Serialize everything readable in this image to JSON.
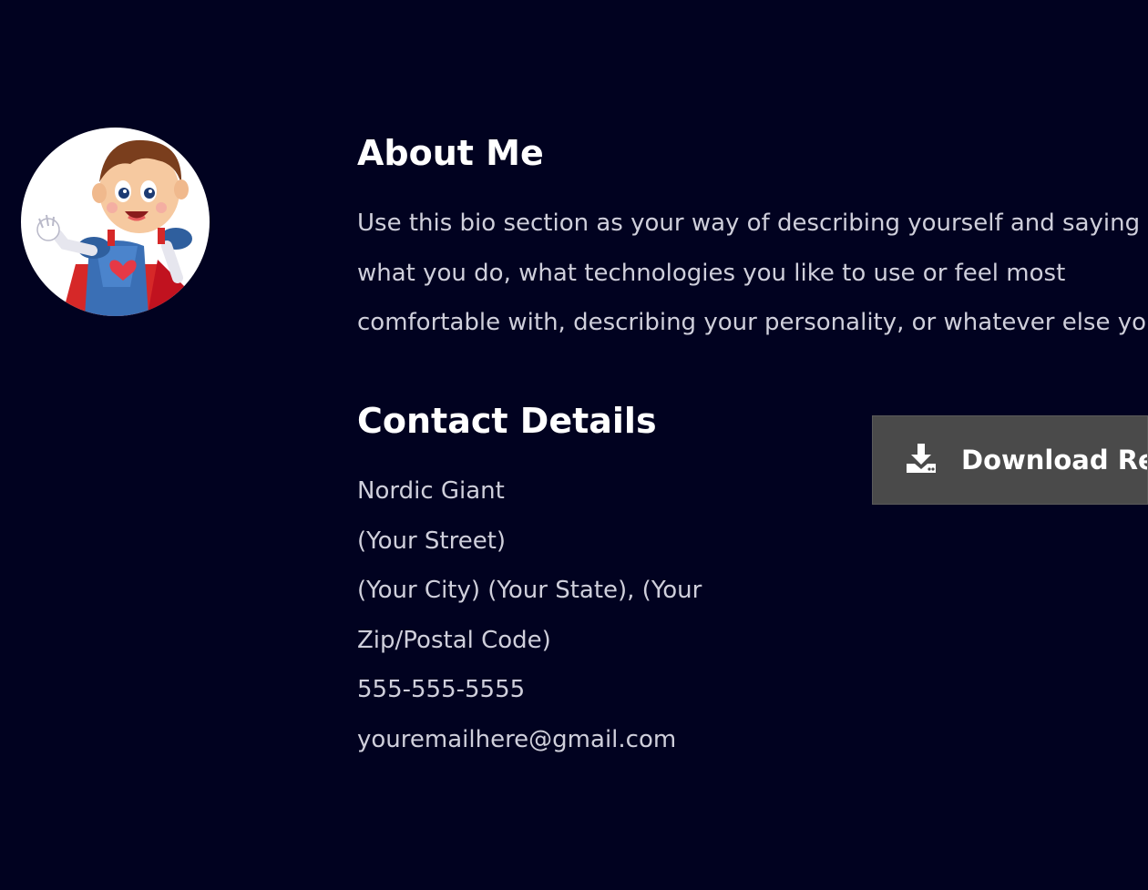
{
  "about": {
    "heading": "About Me",
    "bio": "Use this bio section as your way of describing yourself and saying what you do, what technologies you like to use or feel most comfortable with, describing your personality, or whatever else you feel like throwing in."
  },
  "contact": {
    "heading": "Contact Details",
    "name": "Nordic Giant",
    "street": "(Your Street)",
    "city_state_zip": "(Your City) (Your State), (Your Zip/Postal Code)",
    "phone": "555-555-5555",
    "email": "youremailhere@gmail.com"
  },
  "download": {
    "label": "Download Resume",
    "icon": "download-icon"
  },
  "avatar": {
    "icon": "cartoon-superhero-avatar"
  },
  "colors": {
    "background": "#010220",
    "heading_text": "#ffffff",
    "body_text": "#cfcfdb",
    "button_background": "#4a4a4a"
  }
}
